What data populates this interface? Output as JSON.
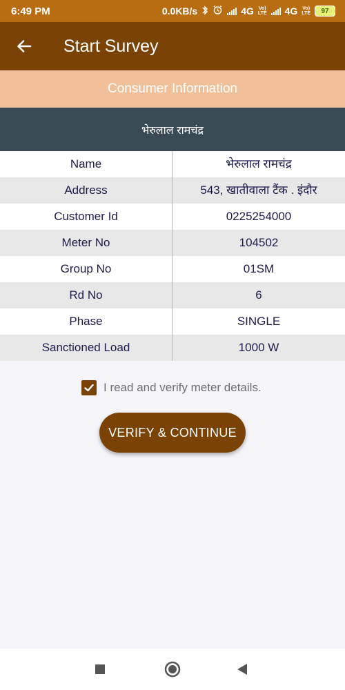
{
  "status_bar": {
    "time": "6:49 PM",
    "network_speed": "0.0KB/s",
    "network1": "4G",
    "network2": "4G",
    "battery": "97",
    "icons": [
      "bluetooth-icon",
      "alarm-icon",
      "signal-icon",
      "volte-icon",
      "battery-icon"
    ]
  },
  "app_bar": {
    "title": "Start Survey",
    "back_icon": "arrow-left-icon"
  },
  "section": {
    "title": "Consumer Information"
  },
  "consumer": {
    "name_header": "भेरुलाल रामचंद्र"
  },
  "details": [
    {
      "label": "Name",
      "value": "भेरुलाल रामचंद्र"
    },
    {
      "label": "Address",
      "value": "543, खातीवाला टैंक . इंदौर"
    },
    {
      "label": "Customer Id",
      "value": "0225254000"
    },
    {
      "label": "Meter No",
      "value": "104502"
    },
    {
      "label": "Group No",
      "value": "01SM"
    },
    {
      "label": "Rd No",
      "value": "6"
    },
    {
      "label": "Phase",
      "value": "SINGLE"
    },
    {
      "label": "Sanctioned Load",
      "value": "1000 W"
    }
  ],
  "verify": {
    "checked": true,
    "label": "I read and verify meter details."
  },
  "actions": {
    "continue_label": "VERIFY & CONTINUE"
  },
  "colors": {
    "status_bar": "#b96d12",
    "app_bar": "#7a4305",
    "section_header": "#f0c09a",
    "consumer_header": "#3a4a55",
    "table_text": "#1b1b4a",
    "divider": "#e8a070"
  }
}
